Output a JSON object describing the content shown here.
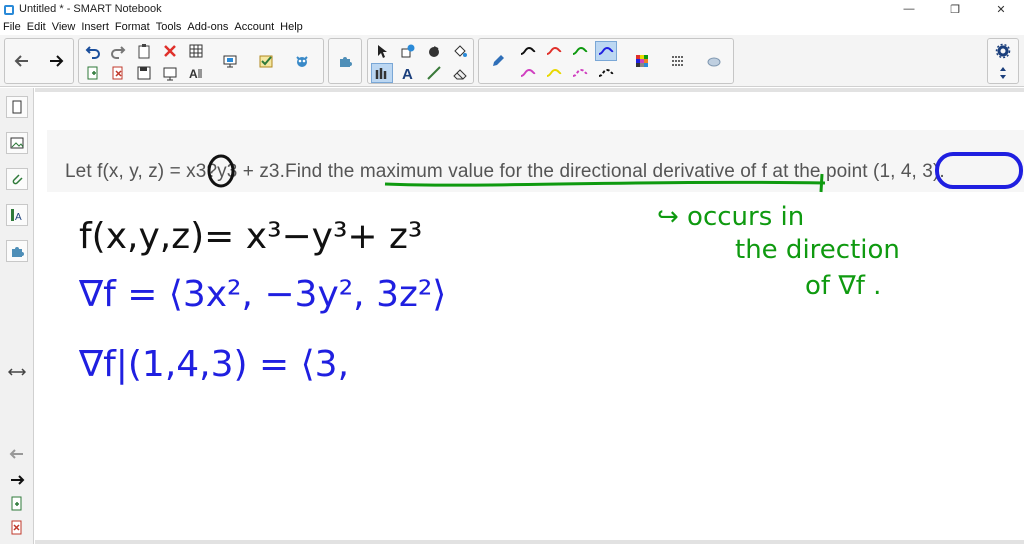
{
  "window": {
    "title": "Untitled * - SMART Notebook",
    "controls": [
      "—",
      "❐",
      "✕"
    ]
  },
  "menu": [
    "File",
    "Edit",
    "View",
    "Insert",
    "Format",
    "Tools",
    "Add-ons",
    "Account",
    "Help"
  ],
  "question": {
    "text": "Let f(x, y, z) = x3?y3 + z3.Find the maximum value for the directional derivative of f at the point (1, 4, 3)."
  },
  "handwriting": {
    "line1": "f(x,y,z)= x³−y³+ z³",
    "line2": "∇f = ⟨3x², −3y², 3z²⟩",
    "line3": "∇f|(1,4,3) = ⟨3,",
    "note1": "↪ occurs in",
    "note2": "the direction",
    "note3": "of ∇f ."
  },
  "colors": {
    "ink_black": "#111111",
    "ink_blue": "#1f1fe0",
    "ink_green": "#0f9a10",
    "pen_red": "#e0302a",
    "pen_pink": "#d040c0",
    "pen_yellow": "#e8d800",
    "selected_highlight": "#bcd7f2"
  }
}
